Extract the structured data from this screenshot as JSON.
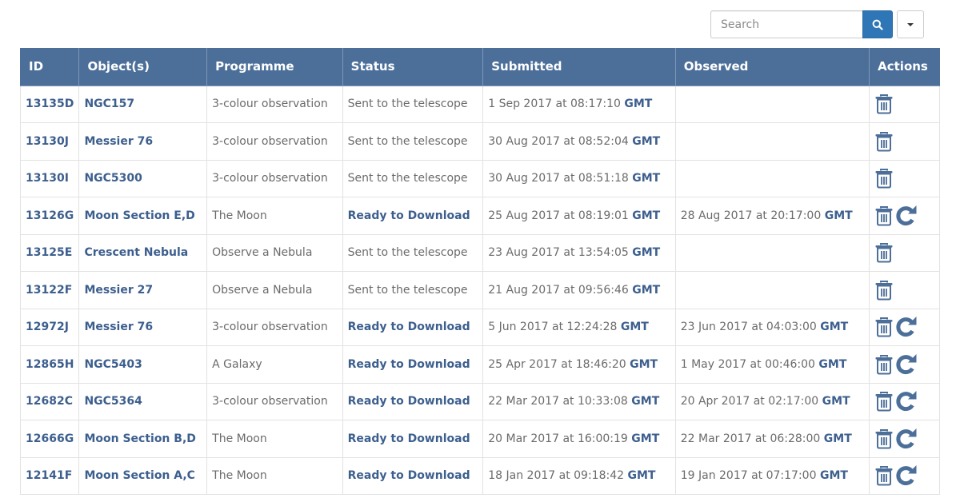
{
  "search": {
    "placeholder": "Search",
    "value": ""
  },
  "icons": {
    "search": "search-icon",
    "dropdown": "caret-down-icon",
    "delete": "trash-icon",
    "retry": "redo-icon"
  },
  "colors": {
    "header_bg": "#4c6f9a",
    "accent": "#2f76b6",
    "link": "#3d5f8e"
  },
  "table": {
    "headers": [
      "ID",
      "Object(s)",
      "Programme",
      "Status",
      "Submitted",
      "Observed",
      "Actions"
    ],
    "rows": [
      {
        "id": "13135D",
        "object": "NGC157",
        "programme": "3-colour observation",
        "status": "Sent to the telescope",
        "status_link": false,
        "submitted": "1 Sep 2017 at 08:17:10",
        "submitted_tz": "GMT",
        "observed": "",
        "observed_tz": "",
        "actions": [
          "delete"
        ]
      },
      {
        "id": "13130J",
        "object": "Messier 76",
        "programme": "3-colour observation",
        "status": "Sent to the telescope",
        "status_link": false,
        "submitted": "30 Aug 2017 at 08:52:04",
        "submitted_tz": "GMT",
        "observed": "",
        "observed_tz": "",
        "actions": [
          "delete"
        ]
      },
      {
        "id": "13130I",
        "object": "NGC5300",
        "programme": "3-colour observation",
        "status": "Sent to the telescope",
        "status_link": false,
        "submitted": "30 Aug 2017 at 08:51:18",
        "submitted_tz": "GMT",
        "observed": "",
        "observed_tz": "",
        "actions": [
          "delete"
        ]
      },
      {
        "id": "13126G",
        "object": "Moon Section E,D",
        "programme": "The Moon",
        "status": "Ready to Download",
        "status_link": true,
        "submitted": "25 Aug 2017 at 08:19:01",
        "submitted_tz": "GMT",
        "observed": "28 Aug 2017 at 20:17:00",
        "observed_tz": "GMT",
        "actions": [
          "delete",
          "retry"
        ]
      },
      {
        "id": "13125E",
        "object": "Crescent Nebula",
        "programme": "Observe a Nebula",
        "status": "Sent to the telescope",
        "status_link": false,
        "submitted": "23 Aug 2017 at 13:54:05",
        "submitted_tz": "GMT",
        "observed": "",
        "observed_tz": "",
        "actions": [
          "delete"
        ]
      },
      {
        "id": "13122F",
        "object": "Messier 27",
        "programme": "Observe a Nebula",
        "status": "Sent to the telescope",
        "status_link": false,
        "submitted": "21 Aug 2017 at 09:56:46",
        "submitted_tz": "GMT",
        "observed": "",
        "observed_tz": "",
        "actions": [
          "delete"
        ]
      },
      {
        "id": "12972J",
        "object": "Messier 76",
        "programme": "3-colour observation",
        "status": "Ready to Download",
        "status_link": true,
        "submitted": "5 Jun 2017 at 12:24:28",
        "submitted_tz": "GMT",
        "observed": "23 Jun 2017 at 04:03:00",
        "observed_tz": "GMT",
        "actions": [
          "delete",
          "retry"
        ]
      },
      {
        "id": "12865H",
        "object": "NGC5403",
        "programme": "A Galaxy",
        "status": "Ready to Download",
        "status_link": true,
        "submitted": "25 Apr 2017 at 18:46:20",
        "submitted_tz": "GMT",
        "observed": "1 May 2017 at 00:46:00",
        "observed_tz": "GMT",
        "actions": [
          "delete",
          "retry"
        ]
      },
      {
        "id": "12682C",
        "object": "NGC5364",
        "programme": "3-colour observation",
        "status": "Ready to Download",
        "status_link": true,
        "submitted": "22 Mar 2017 at 10:33:08",
        "submitted_tz": "GMT",
        "observed": "20 Apr 2017 at 02:17:00",
        "observed_tz": "GMT",
        "actions": [
          "delete",
          "retry"
        ]
      },
      {
        "id": "12666G",
        "object": "Moon Section B,D",
        "programme": "The Moon",
        "status": "Ready to Download",
        "status_link": true,
        "submitted": "20 Mar 2017 at 16:00:19",
        "submitted_tz": "GMT",
        "observed": "22 Mar 2017 at 06:28:00",
        "observed_tz": "GMT",
        "actions": [
          "delete",
          "retry"
        ]
      },
      {
        "id": "12141F",
        "object": "Moon Section A,C",
        "programme": "The Moon",
        "status": "Ready to Download",
        "status_link": true,
        "submitted": "18 Jan 2017 at 09:18:42",
        "submitted_tz": "GMT",
        "observed": "19 Jan 2017 at 07:17:00",
        "observed_tz": "GMT",
        "actions": [
          "delete",
          "retry"
        ]
      }
    ]
  }
}
